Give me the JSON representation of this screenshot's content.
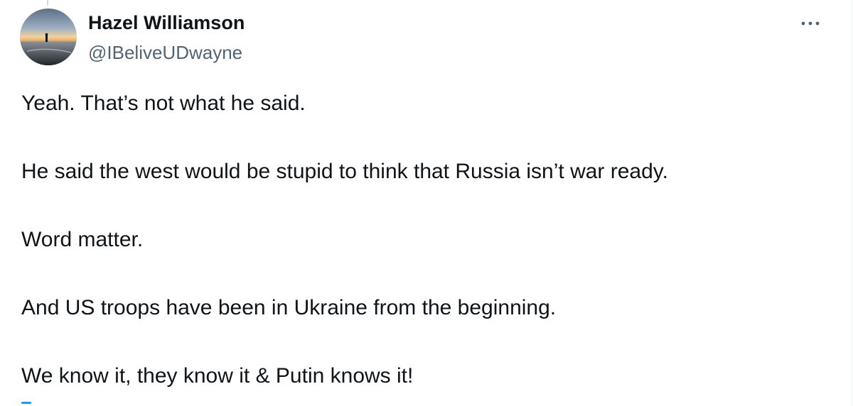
{
  "author": {
    "name": "Hazel Williamson",
    "handle": "@IBeliveUDwayne"
  },
  "tweet": {
    "paragraphs": [
      "Yeah. That’s not what he said.",
      "He said the west would be stupid to think that Russia isn’t war ready.",
      "Word matter.",
      "And US troops have been in Ukraine from the beginning.",
      "We know it, they know it & Putin knows it!"
    ]
  },
  "icons": {
    "more": "more-horizontal-icon",
    "avatar": "avatar-beach-sunset-image"
  },
  "colors": {
    "text_primary": "#0f1419",
    "text_secondary": "#536471",
    "link_blue": "#1d9bf0",
    "thread_line": "#cfd9de"
  }
}
